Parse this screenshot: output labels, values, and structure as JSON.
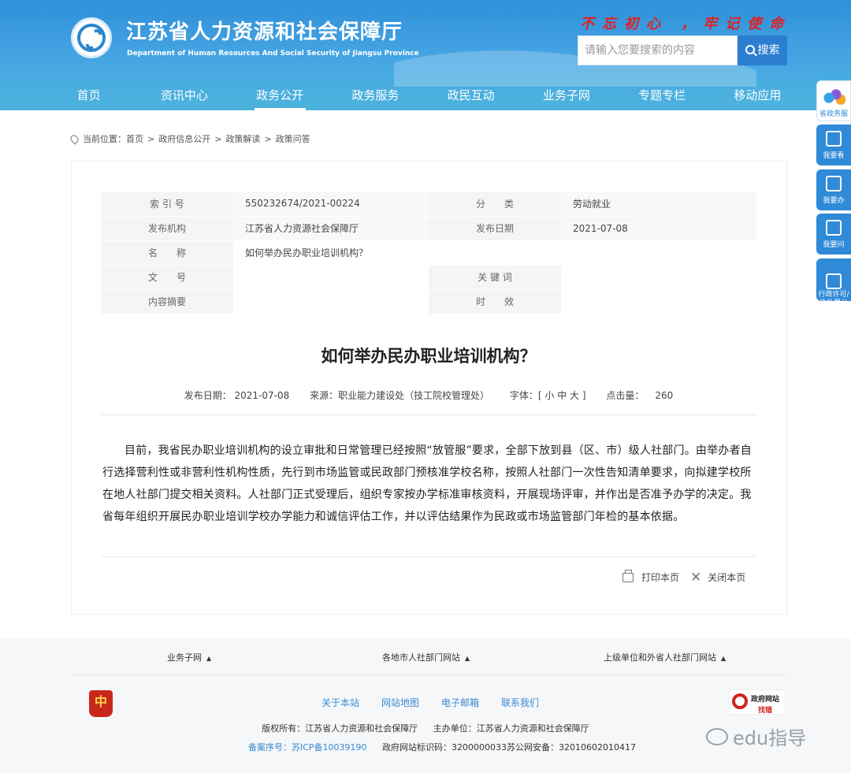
{
  "header": {
    "site_title": "江苏省人力资源和社会保障厅",
    "site_subtitle": "Department of Human Resources And Social Security of Jiangsu Province",
    "slogan": "不忘初心 ，牢记使命",
    "search_placeholder": "请输入您要搜索的内容",
    "search_button": "搜索"
  },
  "nav": [
    "首页",
    "资讯中心",
    "政务公开",
    "政务服务",
    "政民互动",
    "业务子网",
    "专题专栏",
    "移动应用"
  ],
  "side_buttons": [
    "省政务服",
    "我要看",
    "我要办",
    "我要问",
    "行政许可/\n政处罚公"
  ],
  "breadcrumb": {
    "label": "当前位置：",
    "items": [
      "首页",
      "政府信息公开",
      "政策解读",
      "政策问答"
    ]
  },
  "info": {
    "index_label": "索 引 号",
    "index_value": "550232674/2021-00224",
    "category_label": "分　　类",
    "category_value": "劳动就业",
    "org_label": "发布机构",
    "org_value": "江苏省人力资源社会保障厅",
    "date_label": "发布日期",
    "date_value": "2021-07-08",
    "name_label": "名　　称",
    "name_value": "如何举办民办职业培训机构？",
    "docno_label": "文　　号",
    "docno_value": "",
    "keyword_label": "关 键 词",
    "keyword_value": "",
    "abstract_label": "内容摘要",
    "abstract_value": "",
    "validity_label": "时　　效",
    "validity_value": ""
  },
  "article": {
    "title": "如何举办民办职业培训机构？",
    "meta_date": "发布日期：  2021-07-08",
    "meta_source": "来源：职业能力建设处（技工院校管理处）",
    "meta_font": "字体：[  小  中  大  ]",
    "meta_clicks_label": "点击量：",
    "meta_clicks": "260",
    "body": "目前，我省民办职业培训机构的设立审批和日常管理已经按照“放管服”要求，全部下放到县（区、市）级人社部门。由举办者自行选择营利性或非营利性机构性质，先行到市场监管或民政部门预核准学校名称，按照人社部门一次性告知清单要求，向拟建学校所在地人社部门提交相关资料。人社部门正式受理后，组织专家按办学标准审核资料，开展现场评审，并作出是否准予办学的决定。我省每年组织开展民办职业培训学校办学能力和诚信评估工作，并以评估结果作为民政或市场监管部门年检的基本依据。",
    "print": "打印本页",
    "close": "关闭本页"
  },
  "footer": {
    "link_groups": [
      "业务子网",
      "各地市人社部门网站",
      "上级单位和外省人社部门网站"
    ],
    "emblem_char": "中",
    "nav": [
      "关于本站",
      "网站地图",
      "电子邮箱",
      "联系我们"
    ],
    "copyright": "版权所有：江苏省人力资源和社会保障厅",
    "sponsor": "主办单位：江苏省人力资源和社会保障厅",
    "icp": "备案序号：苏ICP备10039190",
    "site_code": "政府网站标识码：3200000033",
    "police": "苏公网安备：32010602010417",
    "findwrong_1": "政府网站",
    "findwrong_2": "找错",
    "watermark": "edu指导"
  },
  "colors": {
    "header_blue": "#2f8fd8",
    "accent_red": "#e02020",
    "link_blue": "#3a8ad0"
  }
}
